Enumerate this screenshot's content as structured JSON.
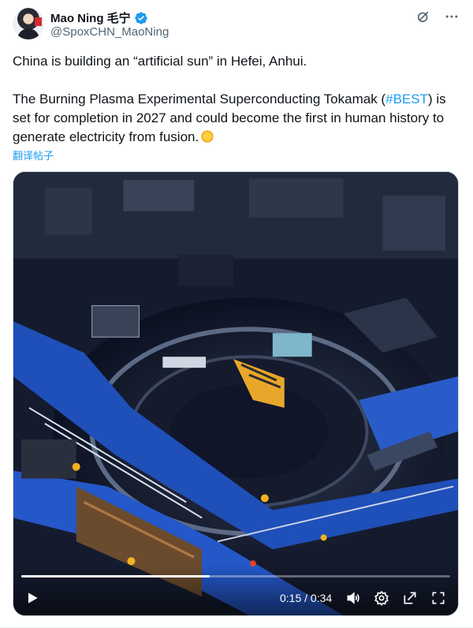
{
  "author": {
    "display_name": "Mao Ning 毛宁",
    "handle": "@SpoxCHN_MaoNing"
  },
  "tweet": {
    "line1": "China is building an “artificial sun” in Hefei, Anhui.",
    "line2_before": "The Burning Plasma Experimental Superconducting Tokamak (",
    "hashtag": "#BEST",
    "line2_after": ") is set for completion in 2027 and could become the first in human history to generate electricity from fusion.",
    "translate_label": "翻译帖子"
  },
  "video": {
    "current_time": "0:15",
    "separator": " / ",
    "duration": "0:34",
    "progress_fraction": 0.44
  },
  "icons": {
    "verified": "verified-badge-icon",
    "grok": "grok-icon",
    "more": "more-icon",
    "play": "play-icon",
    "volume": "volume-icon",
    "settings": "settings-icon",
    "popout": "popout-icon",
    "fullscreen": "fullscreen-icon"
  },
  "colors": {
    "accent": "#1d9bf0",
    "text": "#0f1419",
    "secondary": "#536471"
  }
}
